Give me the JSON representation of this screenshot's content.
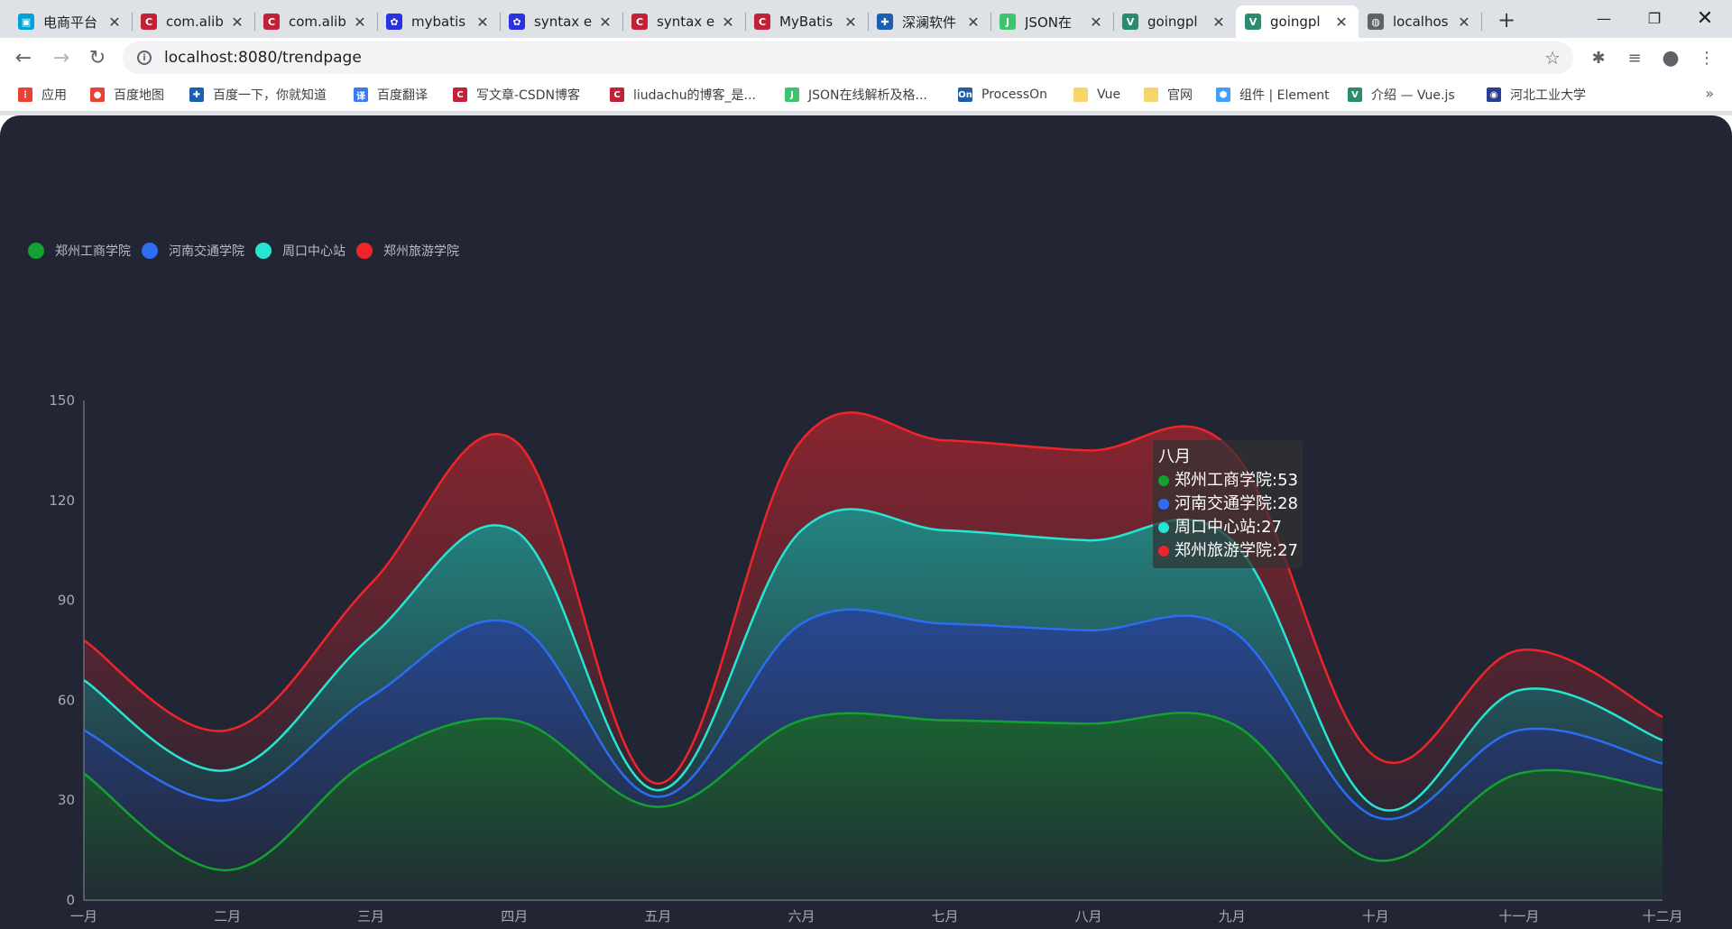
{
  "browser": {
    "tabs": [
      {
        "title": "电商平台",
        "favicon": "bilibili-icon",
        "color": "#00a1d6",
        "glyph": "▣"
      },
      {
        "title": "com.alib",
        "favicon": "csdn-icon",
        "color": "#c32136",
        "glyph": "C"
      },
      {
        "title": "com.alib",
        "favicon": "csdn-icon",
        "color": "#c32136",
        "glyph": "C"
      },
      {
        "title": "mybatis",
        "favicon": "baidu-icon",
        "color": "#2932e1",
        "glyph": "✿"
      },
      {
        "title": "syntax e",
        "favicon": "baidu-icon",
        "color": "#2932e1",
        "glyph": "✿"
      },
      {
        "title": "syntax e",
        "favicon": "csdn-icon",
        "color": "#c32136",
        "glyph": "C"
      },
      {
        "title": "MyBatis",
        "favicon": "csdn-icon",
        "color": "#c32136",
        "glyph": "C"
      },
      {
        "title": "深澜软件",
        "favicon": "shenlan-icon",
        "color": "#1a5fb4",
        "glyph": "✚"
      },
      {
        "title": "JSON在",
        "favicon": "json-icon",
        "color": "#3ec46d",
        "glyph": "J"
      },
      {
        "title": "goingpl",
        "favicon": "vue-icon",
        "color": "#2a8b6f",
        "glyph": "V"
      },
      {
        "title": "goingpl",
        "favicon": "vue-icon",
        "color": "#2a8b6f",
        "glyph": "V",
        "active": true
      },
      {
        "title": "localhos",
        "favicon": "globe-icon",
        "color": "#5f6368",
        "glyph": "◍"
      }
    ],
    "url": "localhost:8080/trendpage",
    "bookmarks": [
      {
        "label": "应用",
        "favicon": "apps-grid-icon",
        "color": "#e94235",
        "glyph": "⋮"
      },
      {
        "label": "百度地图",
        "favicon": "map-pin-icon",
        "color": "#e94235",
        "glyph": "●"
      },
      {
        "label": "百度一下，你就知道",
        "favicon": "shenlan-icon",
        "color": "#1a5fb4",
        "glyph": "✚"
      },
      {
        "label": "百度翻译",
        "favicon": "translate-icon",
        "color": "#3a7cf0",
        "glyph": "译"
      },
      {
        "label": "写文章-CSDN博客",
        "favicon": "csdn-icon",
        "color": "#c32136",
        "glyph": "C"
      },
      {
        "label": "liudachu的博客_是...",
        "favicon": "csdn-icon",
        "color": "#c32136",
        "glyph": "C"
      },
      {
        "label": "JSON在线解析及格...",
        "favicon": "json-icon",
        "color": "#3ec46d",
        "glyph": "J"
      },
      {
        "label": "ProcessOn",
        "favicon": "processon-icon",
        "color": "#1e5fa8",
        "glyph": "On"
      },
      {
        "label": "Vue",
        "favicon": "folder-icon",
        "color": "#f6d56a",
        "glyph": ""
      },
      {
        "label": "官网",
        "favicon": "folder-icon",
        "color": "#f6d56a",
        "glyph": ""
      },
      {
        "label": "组件 | Element",
        "favicon": "element-icon",
        "color": "#409eff",
        "glyph": "⬢"
      },
      {
        "label": "介绍 — Vue.js",
        "favicon": "vue-icon",
        "color": "#2a8b6f",
        "glyph": "V"
      },
      {
        "label": "河北工业大学",
        "favicon": "university-seal-icon",
        "color": "#2c3e8f",
        "glyph": "◉"
      }
    ]
  },
  "chart_data": {
    "type": "area",
    "stacked": true,
    "smooth": true,
    "categories": [
      "一月",
      "二月",
      "三月",
      "四月",
      "五月",
      "六月",
      "七月",
      "八月",
      "九月",
      "十月",
      "十一月",
      "十二月"
    ],
    "series": [
      {
        "name": "郑州工商学院",
        "color": "#13a132",
        "values": [
          38,
          9,
          42,
          54,
          28,
          54,
          54,
          53,
          53,
          12,
          38,
          33
        ]
      },
      {
        "name": "河南交通学院",
        "color": "#2c6df2",
        "values": [
          13,
          21,
          19,
          29,
          3,
          29,
          29,
          28,
          28,
          13,
          13,
          8
        ]
      },
      {
        "name": "周口中心站",
        "color": "#27e5d0",
        "values": [
          15,
          9,
          18,
          28,
          2,
          28,
          28,
          27,
          27,
          3,
          12,
          7
        ]
      },
      {
        "name": "郑州旅游学院",
        "color": "#f0252a",
        "values": [
          12,
          12,
          16,
          27,
          2,
          27,
          27,
          27,
          27,
          15,
          12,
          7
        ]
      }
    ],
    "ylim": [
      0,
      150
    ],
    "yticks": [
      0,
      30,
      60,
      90,
      120,
      150
    ],
    "legend_position": "top-left",
    "tooltip": {
      "title": "八月",
      "items": [
        {
          "name": "郑州工商学院",
          "value": 53
        },
        {
          "name": "河南交通学院",
          "value": 28
        },
        {
          "name": "周口中心站",
          "value": 27
        },
        {
          "name": "郑州旅游学院",
          "value": 27
        }
      ]
    }
  }
}
